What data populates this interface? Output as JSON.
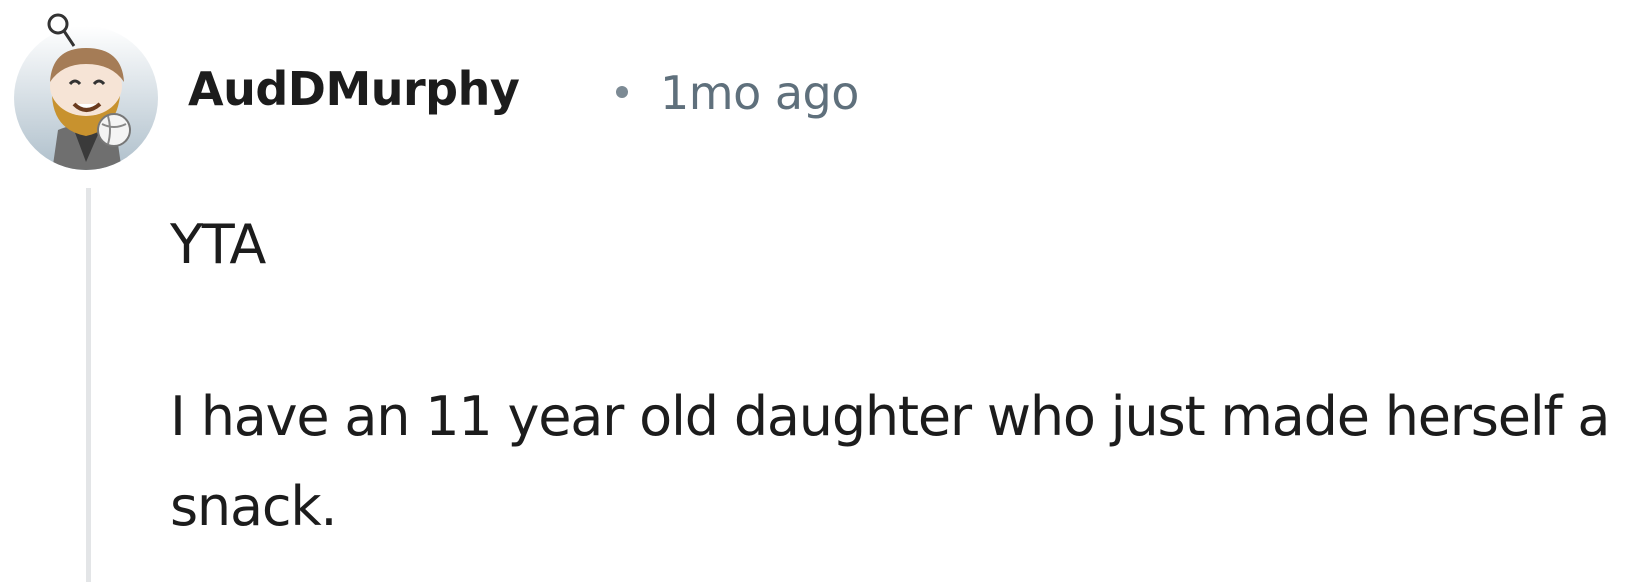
{
  "comment": {
    "author": "AudDMurphy",
    "separator": "•",
    "timestamp": "1mo ago",
    "avatar_icon": "snoo-avatar-icon",
    "paragraphs": [
      "YTA",
      "I have an 11 year old daughter who just made herself a snack."
    ]
  },
  "colors": {
    "author_text": "#1c1c1c",
    "timestamp_text": "#5f707c",
    "thread_line": "#e3e5e7",
    "body_text": "#1c1c1c"
  }
}
